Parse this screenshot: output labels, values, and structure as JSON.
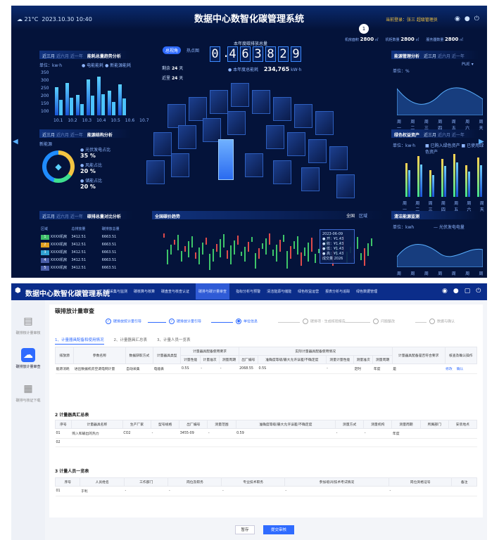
{
  "dashboard": {
    "weather": "21°C",
    "datetime": "2023.10.30  10:40",
    "title": "数据中心数智化碳管理系统",
    "login": "当前登录：张三 超级管理员",
    "left_top": {
      "range": "近三月",
      "opts": "近六月 近一年",
      "title": "能耗总量趋势分析",
      "unit": "单位：kw·h",
      "legend": [
        "电能能耗",
        "新能源能耗"
      ],
      "y_ticks": [
        "350",
        "300",
        "250",
        "200",
        "150",
        "100"
      ],
      "x_ticks": [
        "10.1",
        "10.2",
        "10.3",
        "10.4",
        "10.5",
        "10.6",
        "10.7"
      ],
      "values": [
        220,
        250,
        160,
        280,
        300,
        190,
        240
      ]
    },
    "left_mid": {
      "range": "近三月",
      "opts": "近六月 近一年",
      "title": "能源结构分析",
      "sub": "新能源",
      "items": [
        {
          "label": "光伏发电占比",
          "value": "35 %"
        },
        {
          "label": "风能占比",
          "value": "20 %"
        },
        {
          "label": "储能占比",
          "value": "20 %"
        }
      ]
    },
    "left_bot": {
      "range": "近三月",
      "opts": "近六月 近一年",
      "title": "碳排总量对比分析",
      "headers": [
        "区域",
        "总排放量",
        "碳排放总量"
      ],
      "rows": [
        {
          "rank": "1",
          "name": "XXXX机房",
          "a": "3412.51",
          "b": "6663.51"
        },
        {
          "rank": "2",
          "name": "XXXX机房",
          "a": "3412.51",
          "b": "6663.51"
        },
        {
          "rank": "3",
          "name": "XXXX机房",
          "a": "3412.51",
          "b": "6663.51"
        },
        {
          "rank": "4",
          "name": "XXXX机房",
          "a": "3412.51",
          "b": "6663.51"
        },
        {
          "rank": "5",
          "name": "XXXX机房",
          "a": "3412.51",
          "b": "6663.51"
        }
      ]
    },
    "center": {
      "tabs": [
        "总视角",
        "热点图"
      ],
      "counter_label": "本年度碳排放总量",
      "digits": [
        "0",
        "4",
        "6",
        "3",
        "8",
        "2",
        "9"
      ],
      "sub_label": "本年度总能耗",
      "sub_value": "234,765",
      "sub_unit": "kW·h",
      "days": [
        {
          "label": "剩余",
          "value": "24",
          "unit": "天"
        },
        {
          "label": "近里",
          "value": "24",
          "unit": "天"
        }
      ]
    },
    "top_right": {
      "stats": [
        {
          "label": "机房面积",
          "value": "2800",
          "unit": "㎡"
        },
        {
          "label": "机柜数量",
          "value": "2800",
          "unit": "㎡"
        },
        {
          "label": "服务器数量",
          "value": "2800",
          "unit": "㎡"
        }
      ],
      "marker": "1"
    },
    "right_top": {
      "title": "能源管理分析",
      "range": "近三月",
      "opts": "近六月 近一年",
      "unit": "单位：%",
      "metric": "PUE",
      "x_ticks": [
        "周一",
        "周二",
        "周三",
        "周四",
        "周五",
        "周六",
        "周天"
      ]
    },
    "right_mid": {
      "title": "绿色权益资产",
      "range": "近三月",
      "opts": "近六月 近一年",
      "unit": "单位：kw·h",
      "legend": [
        "已购入绿色资产",
        "已使用绿色资产"
      ],
      "x_ticks": [
        "周一",
        "周二",
        "周三",
        "周四",
        "周五",
        "周六",
        "周天"
      ],
      "values": [
        75,
        90,
        60,
        85,
        95,
        70,
        88
      ]
    },
    "right_bot": {
      "title": "清洁能源监测",
      "unit": "单位：kwh",
      "x_ticks": [
        "周一",
        "周二",
        "周三",
        "周四",
        "周五",
        "周六",
        "周天"
      ],
      "legend": "光伏发电电量"
    },
    "bottom_center": {
      "title": "全国碳价趋势",
      "toggle": [
        "全国",
        "区域"
      ],
      "tooltip": {
        "date": "2023-06-09",
        "rows": [
          {
            "k": "开",
            "v": "¥1.43"
          },
          {
            "k": "收",
            "v": "¥1.43"
          },
          {
            "k": "低",
            "v": "¥1.43"
          },
          {
            "k": "高",
            "v": "¥1.43"
          }
        ],
        "vol_label": "成交量",
        "vol": "2026"
      }
    }
  },
  "app": {
    "title": "数据中心数智化碳管理系统",
    "nav": [
      "数据采集与监测",
      "碳核算与核算",
      "碳盘查与核查认证",
      "碳排与碳计量审查",
      "指标分析与预警",
      "清洁能源与储能",
      "绿色权益运营",
      "报表分析与追踪",
      "绿色数据管理"
    ],
    "nav_active_index": 3,
    "sidebar": [
      {
        "label": "碳排核计量审核",
        "icon": "document-icon"
      },
      {
        "label": "碳排放计量审查",
        "icon": "cloud-icon"
      },
      {
        "label": "碳排与核证下载",
        "icon": "report-icon"
      }
    ],
    "sidebar_active_index": 1,
    "page_title": "碳排放计量审查",
    "steps": [
      {
        "label": "碳排放统计量引导",
        "state": "done"
      },
      {
        "label": "碳排放计量引导",
        "state": "done"
      },
      {
        "label": "单位信息",
        "state": "current"
      },
      {
        "label": "碳排项 · 生成核验报告",
        "state": "todo"
      },
      {
        "label": "问题整改",
        "state": "todo"
      },
      {
        "label": "数据与确认",
        "state": "todo"
      }
    ],
    "tabs": [
      "1、计量器具配备和使用情况",
      "2、计量器具汇总表",
      "3、计量人员一览表"
    ],
    "sec1": {
      "group_headers": [
        "计量器具配备使用要求",
        "实际计量器具配备使用情况"
      ],
      "headers": [
        "排放源",
        "参数名称",
        "数据获取方式",
        "计量器具类型",
        "计量性能",
        "计量准次",
        "测量周期",
        "出厂编号",
        "准确度等级/最大允许误差/不确定度",
        "测量计量性能",
        "测量准次",
        "测量周期",
        "计量器具配备是否符合要求",
        "核查及确认操作"
      ],
      "row": {
        "source": "能源消耗",
        "param": "进出数据机房空调电网计量",
        "method": "自动采集",
        "type": "电能表",
        "perf": "0.5S",
        "times": "-",
        "cycle": "-",
        "serial": "2068.55",
        "accuracy": "0.5S",
        "measure": "-",
        "m_times": "定时",
        "m_cycle": "年度",
        "ok": "是",
        "act1": "修改",
        "act2": "确认"
      }
    },
    "sec2": {
      "title": "2  计量器具汇总表",
      "headers": [
        "序号",
        "计量器具名称",
        "生产厂家",
        "型号规格",
        "出厂编号",
        "测量范围",
        "准确度等级/最大允许误差/不确定度",
        "测量方式",
        "测量机构",
        "测量周期",
        "所属部门",
        "安装地点"
      ],
      "rows": [
        {
          "no": "01",
          "name": "购入和输出的热力",
          "maker": "CO2",
          "model": "-",
          "serial": "3455-09",
          "range": "-",
          "accuracy": "0.59",
          "method": "-",
          "org": "-",
          "cycle": "年度",
          "dept": "",
          "place": ""
        },
        {
          "no": "02",
          "name": "",
          "maker": "",
          "model": "",
          "serial": "",
          "range": "",
          "accuracy": "",
          "method": "",
          "org": "",
          "cycle": "",
          "dept": "",
          "place": ""
        }
      ]
    },
    "sec3": {
      "title": "3  计量人员一览表",
      "headers": [
        "序号",
        "人员姓名",
        "工作部门",
        "岗位及职务",
        "专业技术职务",
        "参加培训/技术考试情况",
        "岗位资格证号",
        "备注"
      ],
      "rows": [
        {
          "no": "01",
          "name": "于利",
          "dept": "-",
          "post": "-",
          "title": "-",
          "train": "-",
          "cert": "-",
          "note": ""
        }
      ]
    },
    "buttons": {
      "save": "暂存",
      "submit": "提交审核"
    }
  }
}
